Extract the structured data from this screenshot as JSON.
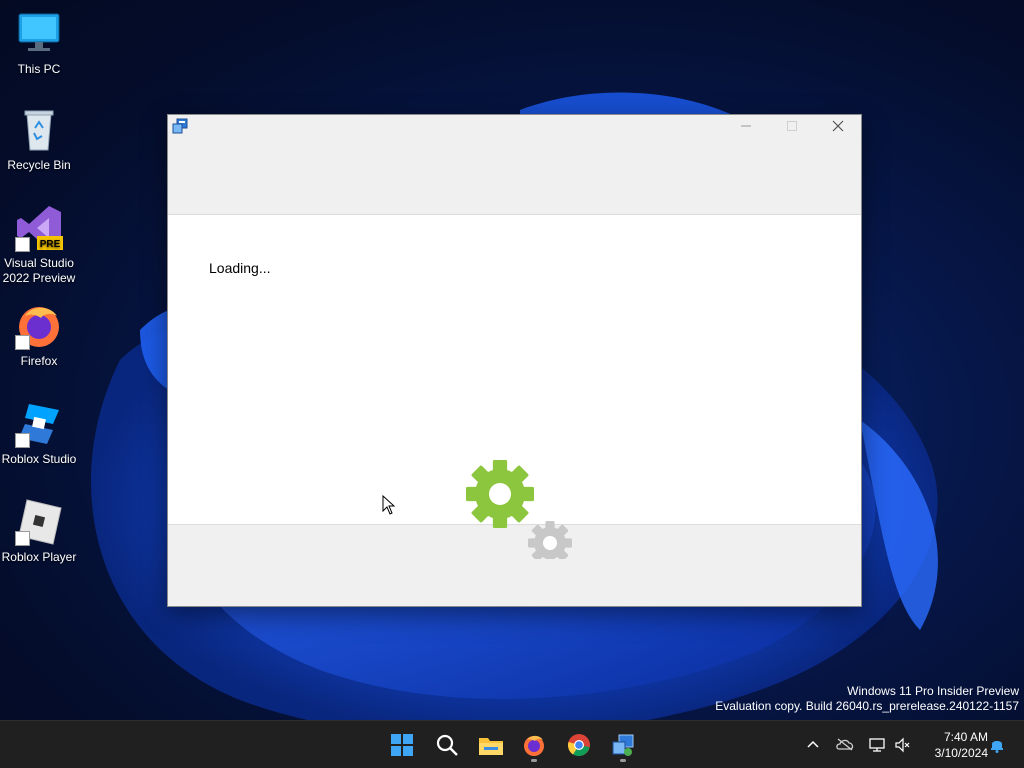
{
  "desktop": {
    "icons": [
      {
        "label": "This PC",
        "icon": "monitor-icon"
      },
      {
        "label": "Recycle Bin",
        "icon": "recycle-bin-icon"
      },
      {
        "label": "Visual Studio 2022 Preview",
        "icon": "visual-studio-icon",
        "badge": "PRE"
      },
      {
        "label": "Firefox",
        "icon": "firefox-icon"
      },
      {
        "label": "Roblox Studio",
        "icon": "roblox-studio-icon"
      },
      {
        "label": "Roblox Player",
        "icon": "roblox-player-icon"
      }
    ],
    "watermark": {
      "line1": "Windows 11 Pro Insider Preview",
      "line2": "Evaluation copy. Build 26040.rs_prerelease.240122-1157"
    }
  },
  "window": {
    "title": "",
    "icon": "installer-icon",
    "loading_text": "Loading...",
    "controls": [
      "minimize-icon",
      "maximize-icon",
      "close-icon"
    ],
    "gear_colors": {
      "primary": "#8cc63f",
      "secondary": "#c8c8c8"
    }
  },
  "taskbar": {
    "apps": [
      "start-icon",
      "search-icon",
      "file-explorer-icon",
      "firefox-icon",
      "chrome-icon",
      "installer-icon"
    ],
    "tray": [
      "chevron-up-icon",
      "onedrive-icon",
      "network-icon",
      "volume-muted-icon",
      "notification-bell-icon"
    ],
    "time": "7:40 AM",
    "date": "3/10/2024"
  },
  "colors": {
    "accent": "#0067c0",
    "taskbar_bg": "#202020"
  }
}
